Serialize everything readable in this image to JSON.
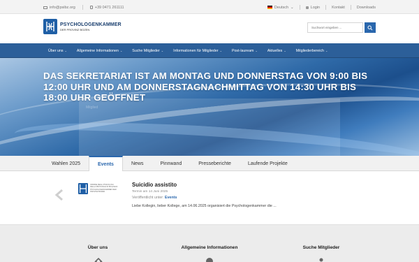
{
  "topbar": {
    "email": "info@psibz.org",
    "phone": "+39 0471 261111",
    "language": "Deutsch",
    "login": "Login",
    "contact": "Kontakt",
    "downloads": "Downloads"
  },
  "header": {
    "logo_title": "PSYCHOLOGENKAMMER",
    "logo_subtitle": "DER PROVINZ BOZEN",
    "search_placeholder": "Suchwort eingeben ..."
  },
  "nav": {
    "items": [
      {
        "label": "Über uns"
      },
      {
        "label": "Allgemeine Informationen"
      },
      {
        "label": "Suche Mitglieder"
      },
      {
        "label": "Informationen für Mitglieder"
      },
      {
        "label": "Post-lauream"
      },
      {
        "label": "Aktuelles"
      },
      {
        "label": "Mitgliederbereich"
      }
    ]
  },
  "hero": {
    "title": "DAS SEKRETARIAT IST AM MONTAG UND DONNERSTAG VON 9:00 BIS 12:00 UHR UND AM DONNERSTAGNACHMITTAG VON 14:30 UHR BIS 18:00 UHR GEÖFFNET",
    "panel_heading": "Mitglied"
  },
  "tabs": {
    "items": [
      {
        "label": "Wahlen 2025",
        "active": false
      },
      {
        "label": "Events",
        "active": true
      },
      {
        "label": "News",
        "active": false
      },
      {
        "label": "Pinnwand",
        "active": false
      },
      {
        "label": "Presseberichte",
        "active": false
      },
      {
        "label": "Laufende Projekte",
        "active": false
      }
    ]
  },
  "event": {
    "logo_lines": "ORDINE DEGLI PSICOLOGI DELLA PROVINCIA DI BOLZANO PSYCHOLOGENKAMMER DER PROVINZ BOZEN",
    "title": "Suicidio assistito",
    "date": "Termin am 14 Juni 2025",
    "published_prefix": "Veröffentlicht unter:",
    "published_category": "Events",
    "excerpt": "Liebe Kollegin, lieber Kollege, am 14.06.2025  organisiert die Psychologenkammer die ..."
  },
  "footer": {
    "col1": "Über uns",
    "col2": "Allgemeine Informationen",
    "col3": "Suche Mitglieder"
  },
  "colors": {
    "brand_blue": "#2c5f99",
    "accent_blue": "#2a67ad",
    "logo_blue": "#1f5fa6"
  }
}
